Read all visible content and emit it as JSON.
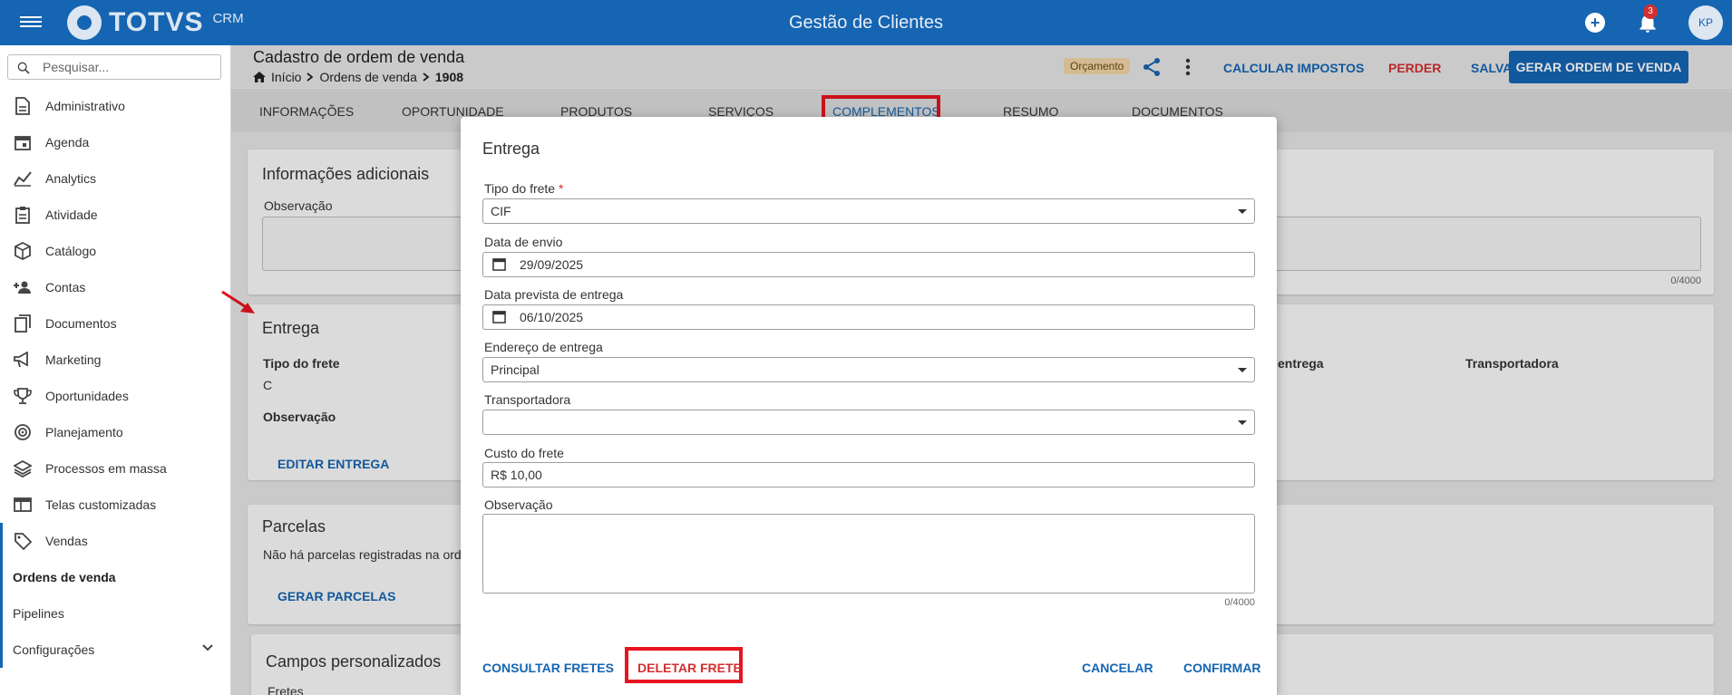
{
  "topbar": {
    "brand": "TOTVS",
    "brand_suffix": "CRM",
    "title": "Gestão de Clientes",
    "notification_count": "3",
    "user_initials": "KP"
  },
  "sidebar": {
    "search_placeholder": "Pesquisar...",
    "items": [
      {
        "label": "Administrativo",
        "icon": "document-icon"
      },
      {
        "label": "Agenda",
        "icon": "calendar-icon"
      },
      {
        "label": "Analytics",
        "icon": "analytics-icon"
      },
      {
        "label": "Atividade",
        "icon": "clipboard-icon"
      },
      {
        "label": "Catálogo",
        "icon": "cube-icon"
      },
      {
        "label": "Contas",
        "icon": "people-icon"
      },
      {
        "label": "Documentos",
        "icon": "documents-icon"
      },
      {
        "label": "Marketing",
        "icon": "megaphone-icon"
      },
      {
        "label": "Oportunidades",
        "icon": "trophy-icon"
      },
      {
        "label": "Planejamento",
        "icon": "target-icon"
      },
      {
        "label": "Processos em massa",
        "icon": "layers-icon"
      },
      {
        "label": "Telas customizadas",
        "icon": "window-icon"
      },
      {
        "label": "Vendas",
        "icon": "tag-icon"
      }
    ],
    "sub_items": [
      "Ordens de venda",
      "Pipelines"
    ],
    "settings_label": "Configurações"
  },
  "page": {
    "title": "Cadastro de ordem de venda",
    "breadcrumb": [
      "Início",
      "Ordens de venda",
      "1908"
    ],
    "status": "Orçamento",
    "actions": {
      "calc_taxes": "CALCULAR IMPOSTOS",
      "lose": "PERDER",
      "save": "SALVAR",
      "generate": "GERAR ORDEM DE VENDA"
    },
    "tabs": [
      "INFORMAÇÕES",
      "OPORTUNIDADE",
      "PRODUTOS",
      "SERVIÇOS",
      "COMPLEMENTOS",
      "RESUMO",
      "DOCUMENTOS"
    ],
    "active_tab": "COMPLEMENTOS",
    "info_card": {
      "title": "Informações adicionais",
      "obs_label": "Observação",
      "counter": "0/4000"
    },
    "entrega_card": {
      "title": "Entrega",
      "tipo_label": "Tipo do frete",
      "tipo_value": "C",
      "obs_label": "Observação",
      "right_label_1": "entrega",
      "right_label_2": "Transportadora",
      "edit_btn": "EDITAR ENTREGA"
    },
    "parcelas_card": {
      "title": "Parcelas",
      "empty_text": "Não há parcelas registradas na ord",
      "gen_btn": "GERAR PARCELAS"
    },
    "custom_card": {
      "title": "Campos personalizados",
      "sub": "Fretes"
    }
  },
  "modal": {
    "title": "Entrega",
    "tipo_frete_label": "Tipo do frete",
    "tipo_frete_required": "*",
    "tipo_frete_value": "CIF",
    "data_envio_label": "Data de envio",
    "data_envio_value": "29/09/2025",
    "data_prevista_label": "Data prevista de entrega",
    "data_prevista_value": "06/10/2025",
    "endereco_label": "Endereço de entrega",
    "endereco_value": "Principal",
    "transportadora_label": "Transportadora",
    "transportadora_value": "",
    "custo_label": "Custo do frete",
    "custo_value": "R$ 10,00",
    "obs_label": "Observação",
    "obs_counter": "0/4000",
    "buttons": {
      "consultar": "CONSULTAR FRETES",
      "deletar": "DELETAR FRETE",
      "cancelar": "CANCELAR",
      "confirmar": "CONFIRMAR"
    }
  },
  "colors": {
    "primary": "#1565b2",
    "danger": "#d32f2f",
    "highlight": "#e8141f"
  }
}
